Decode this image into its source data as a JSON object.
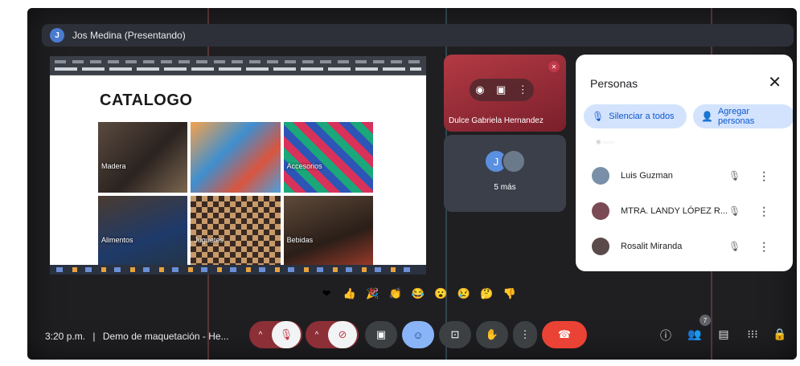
{
  "presenter": {
    "avatar_initial": "J",
    "label": "Jos Medina (Presentando)"
  },
  "shared_screen": {
    "heading": "CATALOGO",
    "tiles": [
      "Madera",
      "",
      "Accesorios",
      "Alimentos",
      "Juguetes",
      "Bebidas"
    ]
  },
  "tiles": {
    "speaker_name": "Dulce Gabriela Hernandez",
    "others_initial": "J",
    "others_more": "5 más"
  },
  "people_panel": {
    "title": "Personas",
    "mute_all_label": "Silenciar a todos",
    "add_people_label": "Agregar personas",
    "participants": [
      {
        "name": "Luis Guzman",
        "avatar_color": "#7a8fa8"
      },
      {
        "name": "MTRA. LANDY LÓPEZ R...",
        "avatar_color": "#7a4a55"
      },
      {
        "name": "Rosalit Miranda",
        "avatar_color": "#5a4a4a"
      }
    ]
  },
  "reactions": [
    "❤",
    "👍",
    "🎉",
    "👏",
    "😂",
    "😮",
    "😢",
    "🤔",
    "👎"
  ],
  "meeting": {
    "time": "3:20 p.m.",
    "separator": "|",
    "name": "Demo de maquetación - He..."
  },
  "people_count": "7",
  "colors": {
    "end_call": "#ea4335",
    "muted_group": "#8c2f36",
    "reactions_active": "#8ab4f8",
    "panel_pill": "#d3e3fd"
  }
}
